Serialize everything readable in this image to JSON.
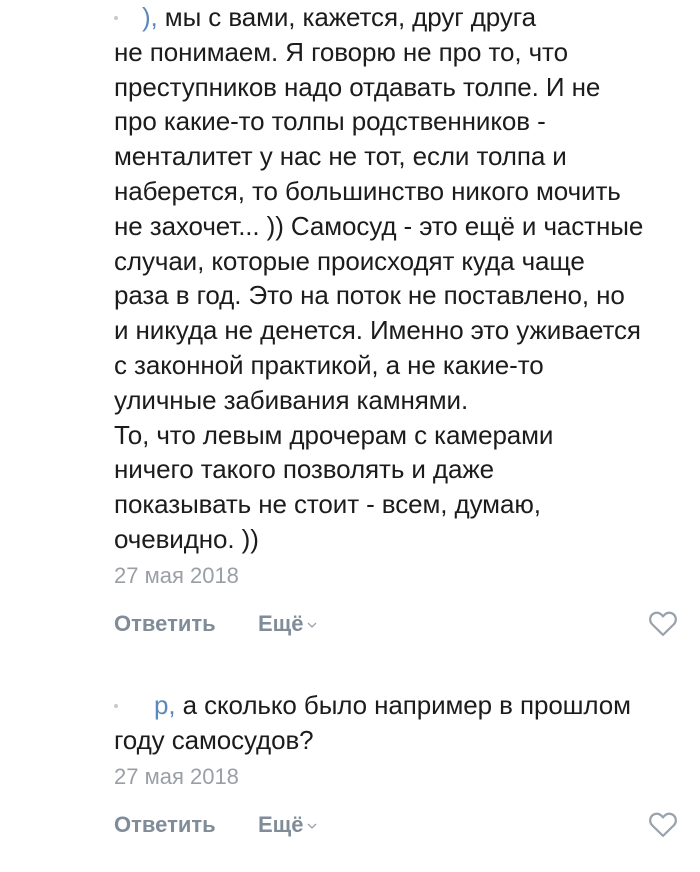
{
  "comments": [
    {
      "mention_fragment": "),",
      "lines": [
        " мы с вами, кажется, друг друга",
        "не понимаем. Я говорю не про то, что",
        "преступников надо отдавать толпе. И не",
        "про какие-то толпы родственников -",
        "менталитет у нас не тот, если толпа и",
        "наберется, то большинство никого мочить",
        "не захочет... )) Самосуд - это ещё и частные",
        "случаи, которые происходят куда чаще",
        "раза в год. Это на поток не поставлено, но",
        "и никуда не денется. Именно это уживается",
        "с законной практикой, а не какие-то",
        "уличные забивания камнями.",
        "То, что левым дрочерам с камерами",
        "ничего такого позволять и даже",
        "показывать не стоит - всем, думаю,",
        "очевидно. ))"
      ],
      "date": "27 мая 2018",
      "reply_label": "Ответить",
      "more_label": "Ещё"
    },
    {
      "mention_fragment": "р,",
      "lines": [
        " а сколько было например в прошлом",
        "году самосудов?"
      ],
      "date": "27 мая 2018",
      "reply_label": "Ответить",
      "more_label": "Ещё"
    }
  ],
  "colors": {
    "text": "#1c1c1c",
    "mention": "#5b88bd",
    "meta": "#9a9ea5",
    "action": "#818c99"
  },
  "icons": {
    "like": "heart-outline-icon",
    "more": "chevron-down-icon"
  }
}
